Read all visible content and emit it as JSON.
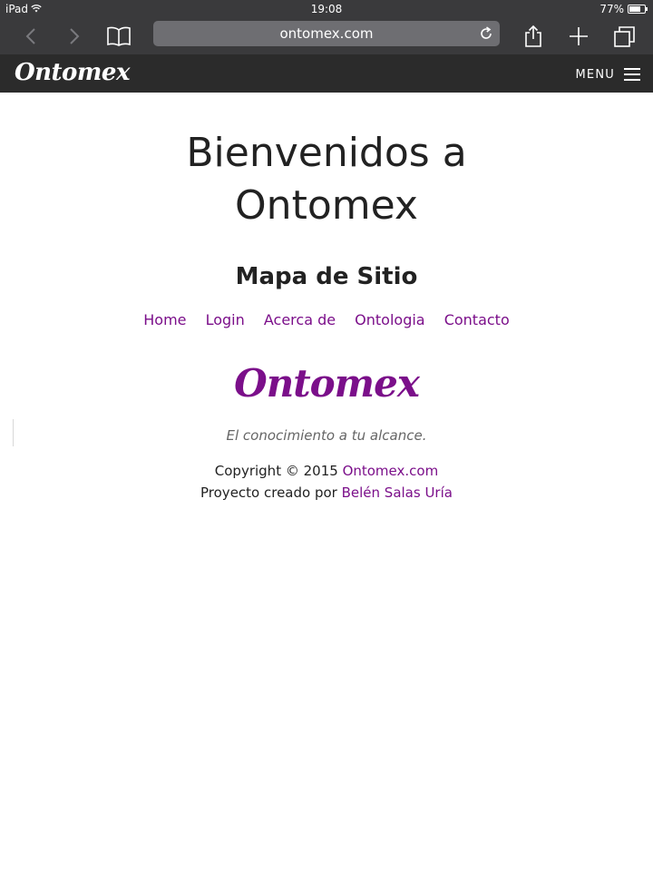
{
  "status_bar": {
    "device": "iPad",
    "time": "19:08",
    "battery": "77%",
    "battery_level": 0.77,
    "icons": [
      "wifi-icon",
      "battery-icon"
    ]
  },
  "browser": {
    "url": "ontomex.com",
    "icons": [
      "back-icon",
      "forward-icon",
      "bookmarks-icon",
      "reload-icon",
      "share-icon",
      "new-tab-icon",
      "tabs-icon"
    ]
  },
  "site_header": {
    "brand": "Ontomex",
    "menu_label": "MENU"
  },
  "main": {
    "headline_line1": "Bienvenidos a",
    "headline_line2": "Ontomex",
    "section_title": "Mapa de Sitio",
    "sitemap_links": [
      "Home",
      "Login",
      "Acerca de",
      "Ontologia",
      "Contacto"
    ]
  },
  "footer": {
    "logo": "Ontomex",
    "tagline": "El conocimiento a tu alcance.",
    "copyright_prefix": "Copyright © 2015 ",
    "copyright_link": "Ontomex.com",
    "credit_prefix": "Proyecto creado por ",
    "credit_link": "Belén Salas Uría"
  },
  "colors": {
    "toolbar": "#3a3a3c",
    "header": "#2b2b2b",
    "accent": "#7b0f8a"
  }
}
